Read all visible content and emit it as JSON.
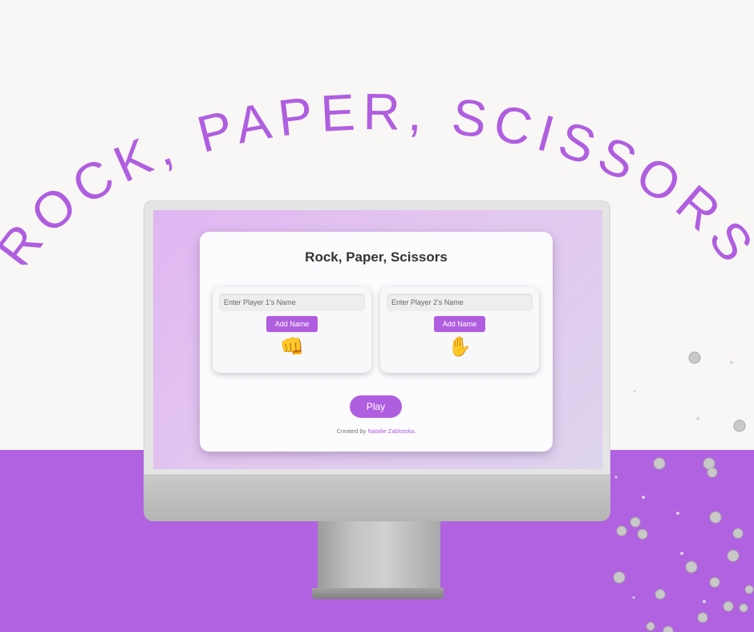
{
  "poster": {
    "headline": "ROCK, PAPER, SCISSORS",
    "colors": {
      "accent": "#b05ee0",
      "background": "#f8f7f5",
      "band": "#b062e0"
    }
  },
  "app": {
    "title": "Rock, Paper, Scissors",
    "player1": {
      "placeholder": "Enter Player 1's Name",
      "button": "Add Name",
      "icon": "👊",
      "icon_name": "fist-icon"
    },
    "player2": {
      "placeholder": "Enter Player 2's Name",
      "button": "Add Name",
      "icon": "✋",
      "icon_name": "raised-hand-icon"
    },
    "play_button": "Play",
    "credit_prefix": "Created by",
    "credit_author": "Natalie Zablotska",
    "credit_suffix": "."
  }
}
